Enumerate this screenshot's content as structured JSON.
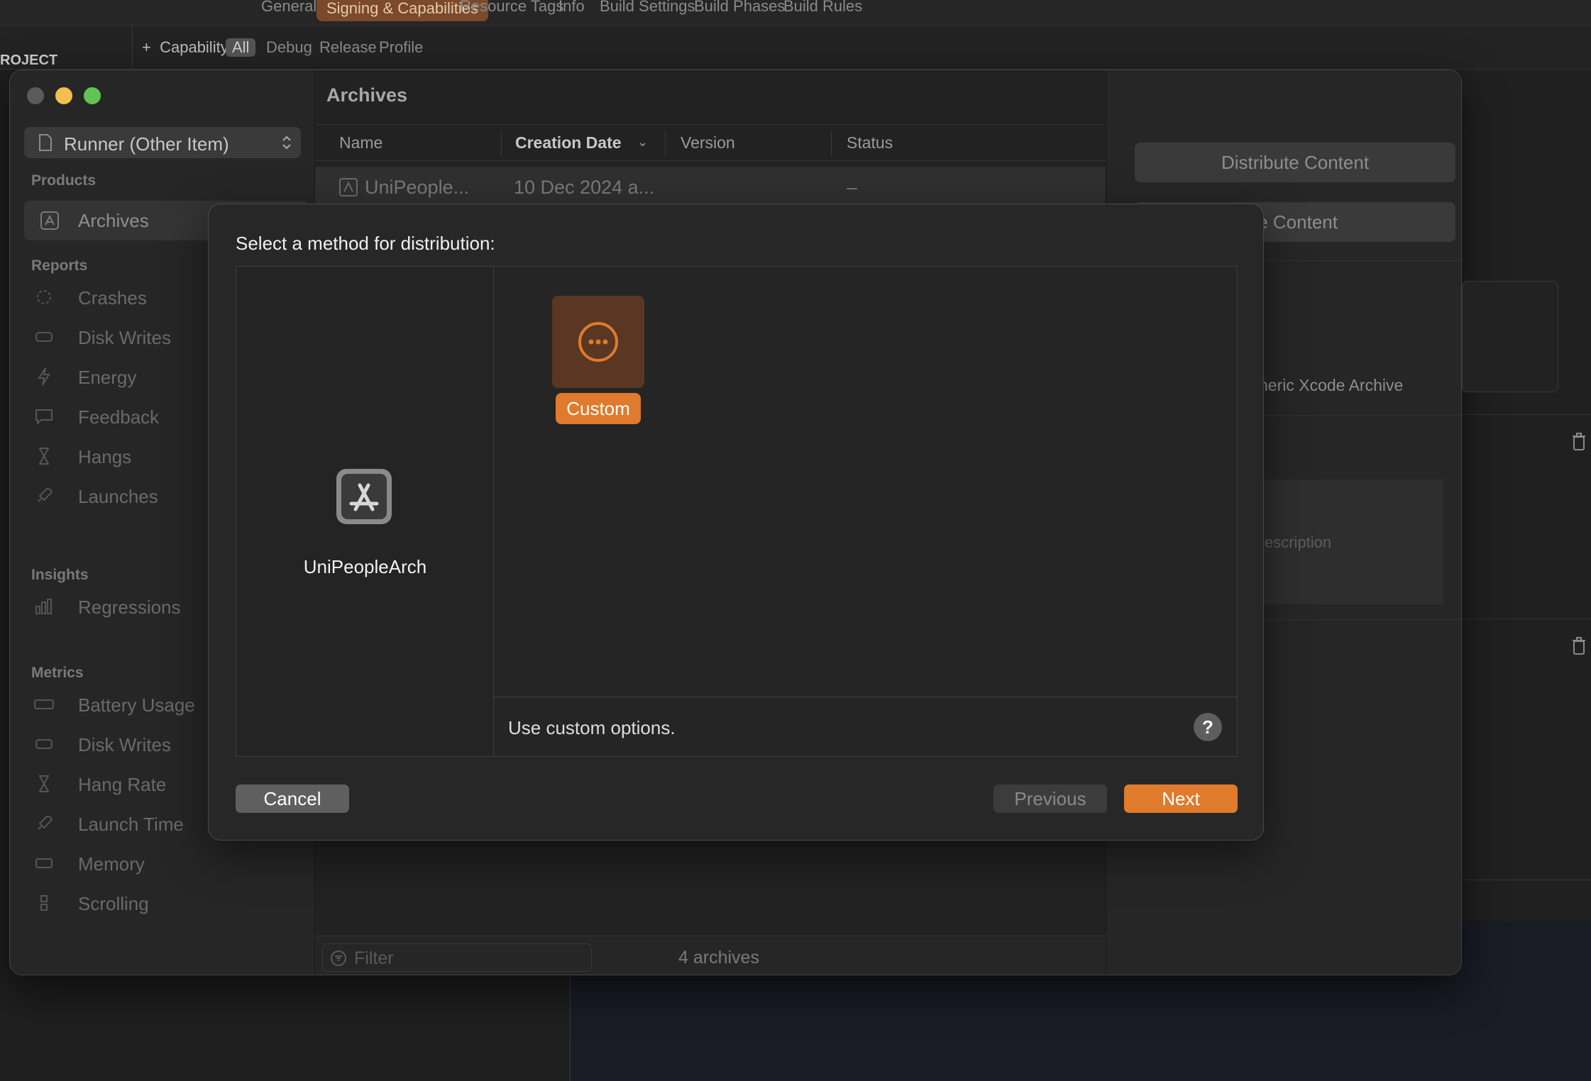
{
  "background": {
    "editor_tabs": [
      "General",
      "Signing & Capabilities",
      "Resource Tags",
      "Info",
      "Build Settings",
      "Build Phases",
      "Build Rules"
    ],
    "active_tab": "Signing & Capabilities",
    "toolbar": {
      "capability_label": "Capability",
      "filters": [
        "All",
        "Debug",
        "Release",
        "Profile"
      ]
    },
    "project_label": "ROJECT"
  },
  "organizer": {
    "scheme": "Runner (Other Item)",
    "sidebar": {
      "products_header": "Products",
      "archives_item": "Archives",
      "reports_header": "Reports",
      "reports_items": [
        "Crashes",
        "Disk Writes",
        "Energy",
        "Feedback",
        "Hangs",
        "Launches"
      ],
      "insights_header": "Insights",
      "insights_items": [
        "Regressions"
      ],
      "metrics_header": "Metrics",
      "metrics_items": [
        "Battery Usage",
        "Disk Writes",
        "Hang Rate",
        "Launch Time",
        "Memory",
        "Scrolling"
      ]
    },
    "main": {
      "title": "Archives",
      "columns": [
        "Name",
        "Creation Date",
        "Version",
        "Status"
      ],
      "row": {
        "name": "UniPeople...",
        "date": "10 Dec 2024 a...",
        "version": "",
        "status": "–"
      },
      "filter_placeholder": "Filter",
      "count": "4 archives"
    },
    "right": {
      "distribute_button": "Distribute Content",
      "validate_button": "te Content",
      "generic_archive": "neric Xcode Archive",
      "description_placeholder": "escription"
    }
  },
  "sheet": {
    "title": "Select a method for distribution:",
    "app_name": "UniPeopleArch",
    "methods": [
      {
        "label": "Custom",
        "selected": true
      }
    ],
    "description": "Use custom options.",
    "help": "?",
    "buttons": {
      "cancel": "Cancel",
      "previous": "Previous",
      "next": "Next"
    }
  },
  "colors": {
    "accent": "#e07a2c",
    "window_bg": "#262626",
    "traffic_red_inactive": "#5a5a5a",
    "traffic_yellow": "#f5bf4f",
    "traffic_green": "#5fc454"
  }
}
